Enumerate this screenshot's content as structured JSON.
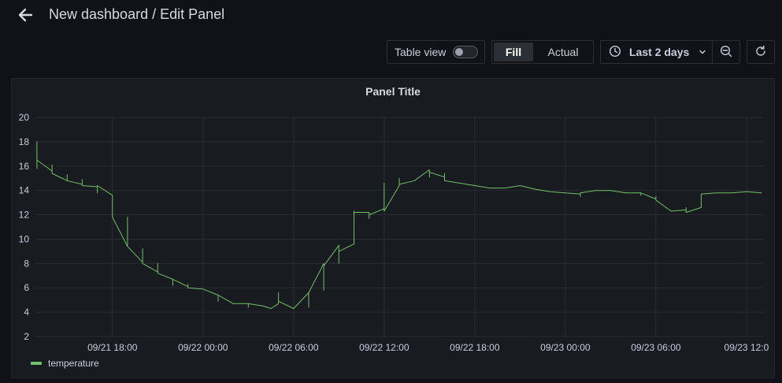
{
  "header": {
    "back_icon": "arrow-left-icon",
    "title": "New dashboard / Edit Panel"
  },
  "toolbar": {
    "table_view_label": "Table view",
    "table_view_on": false,
    "fill_label": "Fill",
    "actual_label": "Actual",
    "time_range_label": "Last 2 days",
    "clock_icon": "clock-icon",
    "chevron_icon": "chevron-down-icon",
    "zoom_icon": "zoom-out-icon",
    "refresh_icon": "refresh-icon"
  },
  "panel": {
    "title": "Panel Title"
  },
  "colors": {
    "background": "#111217",
    "panel": "#181b1f",
    "grid": "#2a2d33",
    "series": "#73bf69"
  },
  "chart_data": {
    "type": "line",
    "title": "Panel Title",
    "ylim": [
      2,
      20
    ],
    "y_ticks": [
      2,
      4,
      6,
      8,
      10,
      12,
      14,
      16,
      18,
      20
    ],
    "x_tick_labels": [
      "09/21 18:00",
      "09/22 00:00",
      "09/22 06:00",
      "09/22 12:00",
      "09/22 18:00",
      "09/23 00:00",
      "09/23 06:00",
      "09/23 12:0"
    ],
    "x_tick_hours": [
      18,
      24,
      30,
      36,
      42,
      48,
      54,
      60
    ],
    "xlim_hours": [
      12.9,
      61.1
    ],
    "grid": true,
    "legend_position": "bottom-left",
    "series": [
      {
        "name": "temperature",
        "color": "#73bf69",
        "x_hours": [
          13.0,
          13.0,
          13.0,
          13.0,
          14.0,
          14.0,
          14.0,
          15.0,
          15.0,
          15.0,
          16.0,
          16.0,
          16.0,
          17.0,
          17.0,
          17.0,
          18.0,
          18.0,
          18.0,
          19.0,
          19.0,
          19.0,
          20.0,
          20.0,
          20.0,
          21.0,
          21.0,
          21.0,
          22.0,
          22.0,
          22.0,
          23.0,
          23.0,
          23.0,
          24.0,
          25.0,
          25.0,
          25.0,
          26.0,
          27.0,
          27.0,
          27.0,
          28.0,
          28.5,
          29.0,
          29.0,
          29.0,
          30.0,
          31.0,
          31.0,
          31.0,
          32.0,
          32.0,
          32.0,
          33.0,
          33.0,
          33.0,
          34.0,
          34.0,
          34.0,
          35.0,
          35.0,
          35.0,
          36.0,
          36.0,
          36.0,
          37.0,
          37.0,
          37.0,
          38.0,
          39.0,
          39.0,
          39.0,
          40.0,
          40.0,
          40.0,
          41.0,
          42.0,
          43.0,
          44.0,
          45.0,
          46.0,
          47.0,
          48.0,
          49.0,
          49.0,
          49.0,
          50.0,
          51.0,
          52.0,
          53.0,
          53.0,
          53.0,
          54.0,
          54.0,
          54.0,
          55.0,
          56.0,
          56.0,
          56.0,
          57.0,
          57.0,
          57.0,
          58.0,
          59.0,
          60.0,
          61.0
        ],
        "values": [
          16.5,
          18.0,
          15.8,
          16.5,
          15.6,
          16.1,
          15.4,
          14.8,
          15.3,
          14.8,
          14.5,
          14.9,
          14.4,
          14.3,
          13.8,
          14.4,
          13.6,
          12.0,
          11.8,
          9.4,
          11.8,
          9.4,
          8.1,
          9.2,
          8.0,
          7.3,
          8.0,
          7.2,
          6.7,
          6.2,
          6.7,
          6.1,
          6.3,
          6.0,
          5.9,
          5.4,
          4.9,
          5.4,
          4.7,
          4.7,
          4.4,
          4.7,
          4.5,
          4.3,
          4.7,
          5.6,
          4.9,
          4.3,
          5.6,
          4.4,
          5.6,
          8.0,
          5.8,
          7.8,
          9.5,
          8.0,
          9.0,
          9.6,
          12.3,
          12.2,
          12.2,
          11.7,
          12.0,
          12.5,
          14.6,
          12.3,
          14.4,
          15.0,
          14.5,
          14.8,
          15.7,
          15.1,
          15.5,
          15.1,
          15.4,
          14.8,
          14.6,
          14.4,
          14.2,
          14.2,
          14.4,
          14.1,
          13.9,
          13.8,
          13.7,
          13.5,
          13.8,
          14.0,
          14.0,
          13.8,
          13.8,
          13.6,
          13.8,
          13.3,
          13.5,
          13.2,
          12.3,
          12.4,
          12.6,
          12.2,
          12.6,
          13.3,
          13.7,
          13.8,
          13.8,
          13.9,
          13.8
        ]
      }
    ]
  }
}
